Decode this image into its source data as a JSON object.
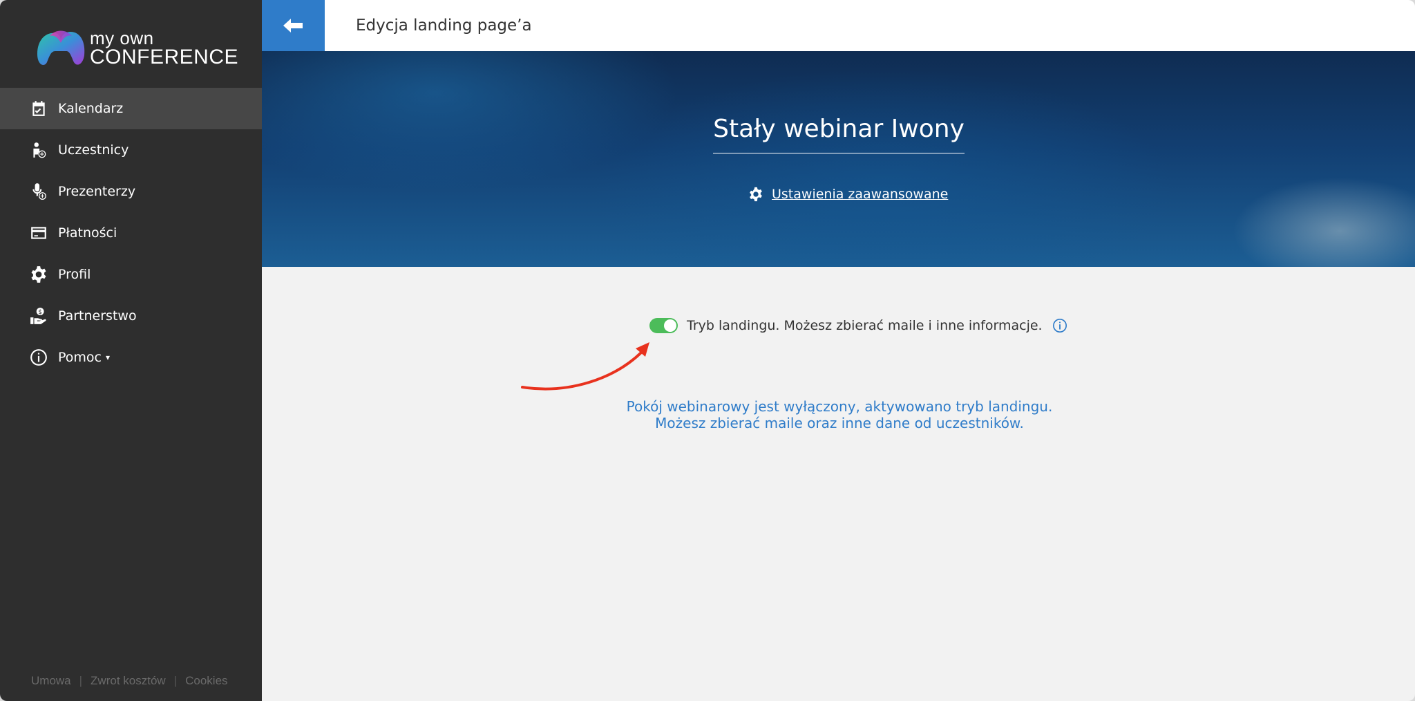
{
  "brand": {
    "line1": "my own",
    "line2": "CONFERENCE"
  },
  "sidebar": {
    "items": [
      {
        "label": "Kalendarz",
        "icon": "calendar-check-icon",
        "active": true
      },
      {
        "label": "Uczestnicy",
        "icon": "user-plus-icon"
      },
      {
        "label": "Prezenterzy",
        "icon": "microphone-user-icon"
      },
      {
        "label": "Płatności",
        "icon": "credit-card-icon"
      },
      {
        "label": "Profil",
        "icon": "gear-icon"
      },
      {
        "label": "Partnerstwo",
        "icon": "hand-coin-icon"
      },
      {
        "label": "Pomoc",
        "icon": "info-circle-icon",
        "caret": "▾"
      }
    ],
    "footer": {
      "links": [
        "Umowa",
        "Zwrot kosztów",
        "Cookies"
      ],
      "separator": "|"
    }
  },
  "topbar": {
    "title": "Edycja landing page’a",
    "back_icon": "arrow-left-icon"
  },
  "hero": {
    "title": "Stały webinar Iwony",
    "advanced_settings_label": "Ustawienia zaawansowane"
  },
  "landing": {
    "toggle_on": true,
    "toggle_label": "Tryb landingu. Możesz zbierać maile i inne informacje.",
    "notice": "Pokój webinarowy jest wyłączony, aktywowano tryb landingu. Możesz zbierać maile oraz inne dane od uczestników."
  },
  "colors": {
    "accent": "#2f7cc9",
    "toggle_on": "#4cbc5a",
    "sidebar_bg": "#2e2e2e",
    "annotation_arrow": "#e8321e"
  }
}
